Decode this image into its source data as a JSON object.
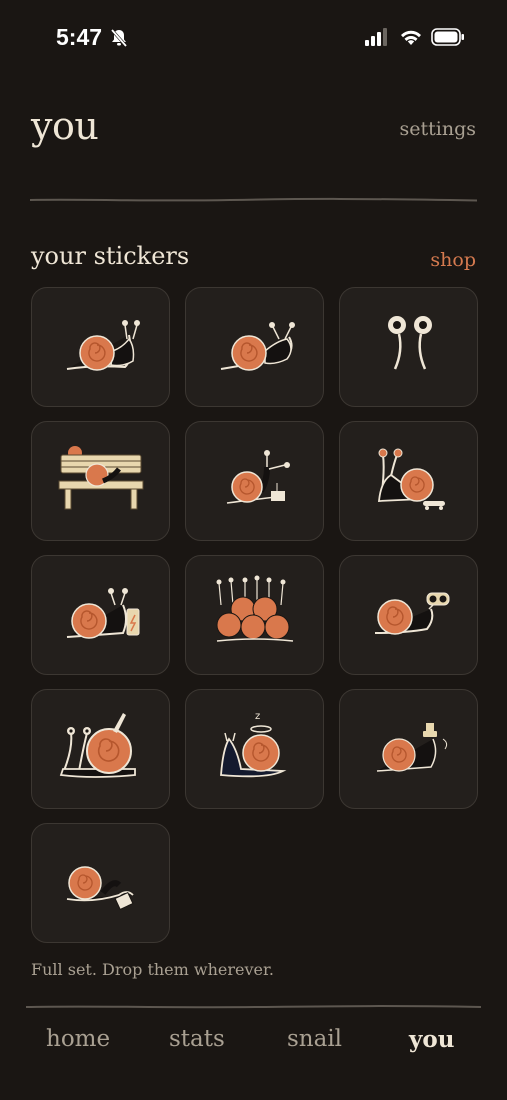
{
  "status_bar": {
    "time": "5:47"
  },
  "header": {
    "title": "you",
    "settings_label": "settings"
  },
  "stickers_section": {
    "title": "your stickers",
    "shop_label": "shop"
  },
  "stickers": [
    {
      "icon": "snail-sticker"
    },
    {
      "icon": "snail-looking-back-sticker"
    },
    {
      "icon": "snail-eyes-sticker"
    },
    {
      "icon": "snail-on-bench-sticker"
    },
    {
      "icon": "snail-with-sign-sticker"
    },
    {
      "icon": "snail-on-skateboard-sticker"
    },
    {
      "icon": "snail-with-battery-sticker"
    },
    {
      "icon": "snail-crowd-sticker"
    },
    {
      "icon": "snail-with-binoculars-sticker"
    },
    {
      "icon": "snail-with-knife-sticker"
    },
    {
      "icon": "snail-with-halo-sticker"
    },
    {
      "icon": "snail-with-hat-sticker"
    },
    {
      "icon": "snail-sleeping-sticker"
    }
  ],
  "footnote": "Full set. Drop them wherever.",
  "tabs": [
    {
      "label": "home"
    },
    {
      "label": "stats"
    },
    {
      "label": "snail"
    },
    {
      "label": "you",
      "active": true
    }
  ],
  "colors": {
    "background": "#1a1613",
    "tile": "#231f1c",
    "accent": "#d57a4f",
    "text": "#efe6d6",
    "muted": "#a9a092"
  }
}
